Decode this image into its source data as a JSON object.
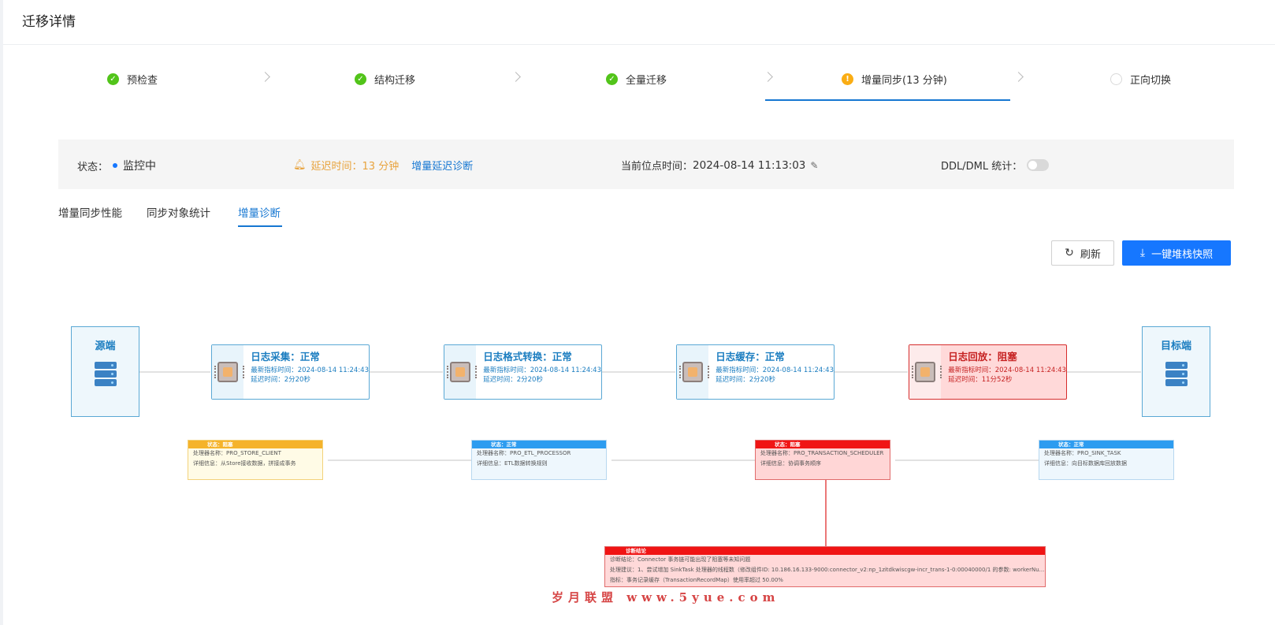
{
  "header": {
    "title": "迁移详情"
  },
  "steps": [
    {
      "label": "预检查",
      "status": "done"
    },
    {
      "label": "结构迁移",
      "status": "done"
    },
    {
      "label": "全量迁移",
      "status": "done"
    },
    {
      "label": "增量同步(13 分钟)",
      "status": "warning",
      "active": true
    },
    {
      "label": "正向切换",
      "status": "pending"
    }
  ],
  "statusbar": {
    "state_label": "状态：",
    "state_value": "监控中",
    "delay_text": "延迟时间：13 分钟",
    "delay_link": "增量延迟诊断",
    "position_label": "当前位点时间：",
    "position_value": "2024-08-14 11:13:03",
    "ddl_label": "DDL/DML 统计：",
    "ddl_enabled": false
  },
  "tabs": [
    {
      "label": "增量同步性能",
      "active": false
    },
    {
      "label": "同步对象统计",
      "active": false
    },
    {
      "label": "增量诊断",
      "active": true
    }
  ],
  "actions": {
    "refresh_label": "刷新",
    "snapshot_label": "一键堆栈快照"
  },
  "diagram": {
    "source_label": "源端",
    "target_label": "目标端",
    "processes": [
      {
        "name": "日志采集：正常",
        "time": "最新指标时间：2024-08-14 11:24:43",
        "delay": "延迟时间：2分20秒",
        "status": "normal"
      },
      {
        "name": "日志格式转换：正常",
        "time": "最新指标时间：2024-08-14 11:24:43",
        "delay": "延迟时间：2分20秒",
        "status": "normal"
      },
      {
        "name": "日志缓存：正常",
        "time": "最新指标时间：2024-08-14 11:24:43",
        "delay": "延迟时间：2分20秒",
        "status": "normal"
      },
      {
        "name": "日志回放：阻塞",
        "time": "最新指标时间：2024-08-14 11:24:43",
        "delay": "延迟时间：11分52秒",
        "status": "blocked"
      }
    ],
    "workers": [
      {
        "header": "状态：阻塞",
        "name": "处理器名称：PRO_STORE_CLIENT",
        "detail": "详细信息：从Store接收数据，拼接成事务",
        "color": "yellow"
      },
      {
        "header": "状态：正常",
        "name": "处理器名称：PRO_ETL_PROCESSOR",
        "detail": "详细信息：ETL数据转换规则",
        "color": "blue"
      },
      {
        "header": "状态：阻塞",
        "name": "处理器名称：PRO_TRANSACTION_SCHEDULER",
        "detail": "详细信息：协调事务顺序",
        "color": "red"
      },
      {
        "header": "状态：正常",
        "name": "处理器名称：PRO_SINK_TASK",
        "detail": "详细信息：向目标数据库回放数据",
        "color": "blue"
      }
    ],
    "diagnosis": {
      "header": "诊断结论",
      "conclusion": "诊断结论：Connector 事务链可能出现了阻塞等未知问题",
      "suggestion": "处理建议：1、尝试增加 SinkTask 处理器的线程数（修改组件ID: 10.186.16.133-9000:connector_v2:np_1zitdkwiscgw-incr_trans-1-0:00040000/1 的参数: workerNu...",
      "metric": "指标：事务记录缓存（TransactionRecordMap）使用率超过 50.00%"
    }
  },
  "watermark": "岁月联盟 www.5yue.com",
  "colors": {
    "primary": "#1677ff",
    "ok": "#52c41a",
    "warn": "#faad14",
    "danger": "#f01414"
  }
}
